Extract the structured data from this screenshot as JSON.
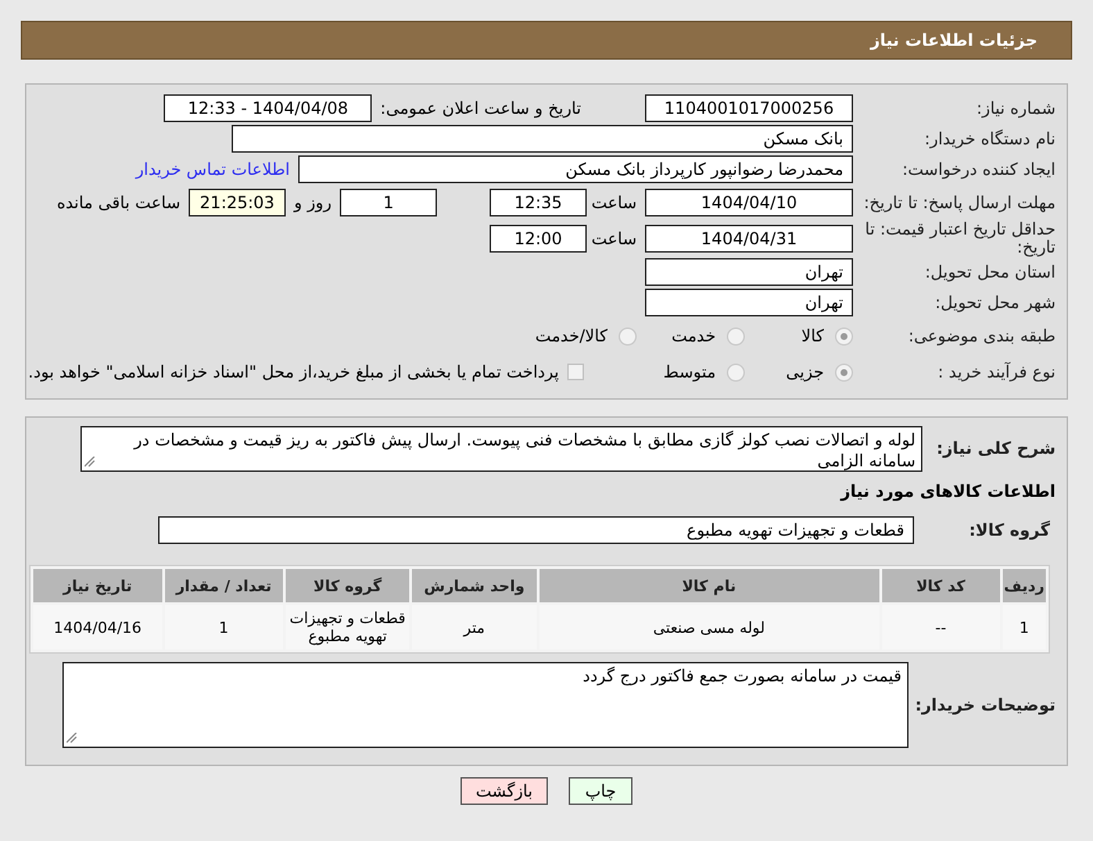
{
  "header": {
    "title": "جزئیات اطلاعات نیاز"
  },
  "need_number": {
    "label": "شماره نیاز:",
    "value": "1104001017000256"
  },
  "announce": {
    "label": "تاریخ و ساعت اعلان عمومی:",
    "value": "1404/04/08 - 12:33"
  },
  "buyer_org": {
    "label": "نام دستگاه خریدار:",
    "value": "بانک مسکن"
  },
  "requester": {
    "label": "ایجاد کننده درخواست:",
    "value": "محمدرضا رضوانپور کارپرداز بانک مسکن",
    "link": "اطلاعات تماس خریدار"
  },
  "reply_deadline": {
    "label": "مهلت ارسال پاسخ: تا تاریخ:",
    "date": "1404/04/10",
    "time_label": "ساعت",
    "time": "12:35",
    "days": "1",
    "days_label": "روز و",
    "remaining": "21:25:03",
    "remaining_label": "ساعت باقی مانده"
  },
  "price_validity": {
    "label": "حداقل تاریخ اعتبار قیمت: تا تاریخ:",
    "date": "1404/04/31",
    "time_label": "ساعت",
    "time": "12:00"
  },
  "province": {
    "label": "استان محل تحویل:",
    "value": "تهران"
  },
  "city": {
    "label": "شهر محل تحویل:",
    "value": "تهران"
  },
  "category": {
    "label": "طبقه بندی موضوعی:",
    "options": [
      {
        "label": "کالا",
        "selected": true
      },
      {
        "label": "خدمت",
        "selected": false
      },
      {
        "label": "کالا/خدمت",
        "selected": false
      }
    ]
  },
  "process": {
    "label": "نوع فرآیند خرید :",
    "options": [
      {
        "label": "جزیی",
        "selected": true
      },
      {
        "label": "متوسط",
        "selected": false
      }
    ],
    "payment": {
      "label": "پرداخت تمام یا بخشی از مبلغ خرید،از محل \"اسناد خزانه اسلامی\" خواهد بود.",
      "checked": false
    }
  },
  "description": {
    "label": "شرح کلی نیاز:",
    "value": "لوله و اتصالات نصب کولز گازی مطابق با مشخصات فنی پیوست. ارسال پیش فاکتور به ریز قیمت و مشخصات در سامانه الزامی"
  },
  "goods_title": "اطلاعات کالاهای مورد نیاز",
  "goods_group": {
    "label": "گروه کالا:",
    "value": "قطعات و تجهیزات تهویه مطبوع"
  },
  "table": {
    "columns": [
      "ردیف",
      "کد کالا",
      "نام کالا",
      "واحد شمارش",
      "گروه کالا",
      "تعداد / مقدار",
      "تاریخ نیاز"
    ],
    "rows": [
      [
        "1",
        "--",
        "لوله مسی صنعتی",
        "متر",
        "قطعات و تجهیزات تهویه مطبوع",
        "1",
        "1404/04/16"
      ]
    ]
  },
  "buyer_notes": {
    "label": "توضیحات خریدار:",
    "value": "قیمت در سامانه بصورت جمع فاکتور درج گردد"
  },
  "buttons": [
    {
      "label": "چاپ",
      "kind": "print"
    },
    {
      "label": "بازگشت",
      "kind": "back"
    }
  ]
}
